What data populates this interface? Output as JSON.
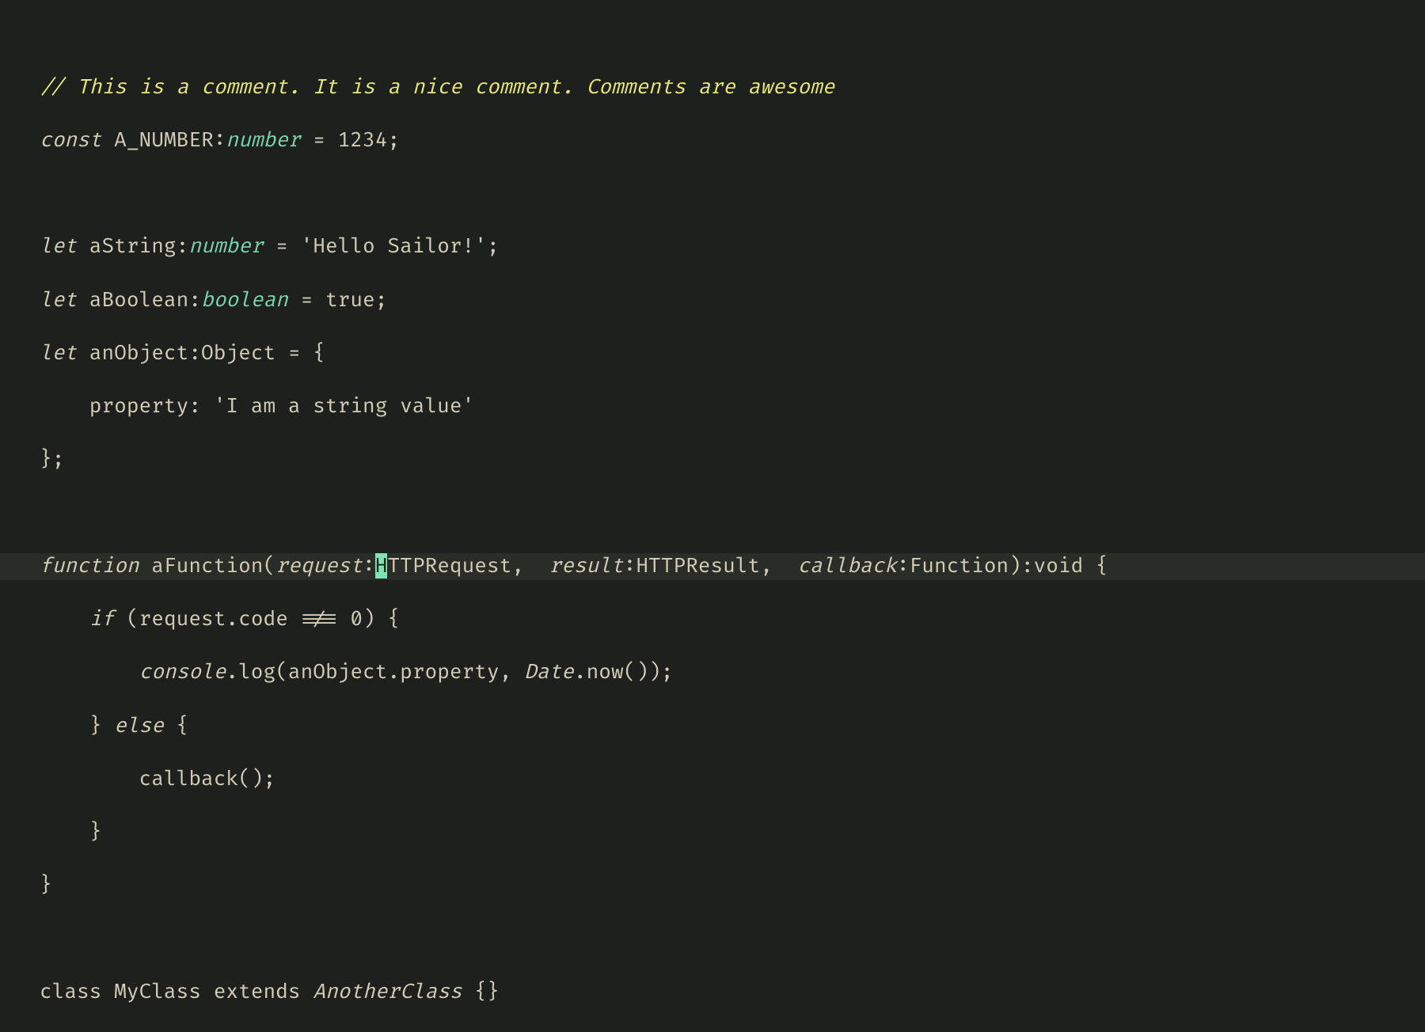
{
  "theme": {
    "bg": "#1d201c",
    "fg": "#d3cdb8",
    "comment": "#e6e87a",
    "typeAccent": "#79d4ad",
    "cursorBg": "#7fe3b4",
    "lineHighlight": "#2a2d27"
  },
  "cursor": {
    "line": 10,
    "col": 28,
    "char": "H"
  },
  "code": {
    "l1": {
      "comment": "// This is a comment. It is a nice comment. Comments are awesome"
    },
    "l2": {
      "kw": "const",
      "name": "A_NUMBER",
      "colon": ":",
      "type": "number",
      "eq": " = ",
      "val": "1234",
      "semi": ";"
    },
    "l4": {
      "kw": "let",
      "name": "aString",
      "colon": ":",
      "type": "number",
      "eq": " = ",
      "val": "'Hello Sailor!'",
      "semi": ";"
    },
    "l5": {
      "kw": "let",
      "name": "aBoolean",
      "colon": ":",
      "type": "boolean",
      "eq": " = ",
      "val": "true",
      "semi": ";"
    },
    "l6": {
      "kw": "let",
      "name": "anObject",
      "colon": ":",
      "type": "Object",
      "eq": " = ",
      "brace": "{"
    },
    "l7": {
      "indent": "    ",
      "prop": "property",
      "colon": ": ",
      "val": "'I am a string value'"
    },
    "l8": {
      "close": "};"
    },
    "l10": {
      "kw": "function",
      "name": "aFunction",
      "open": "(",
      "p1": "request",
      "c1": ":",
      "t1a": "H",
      "t1b": "TTPRequest",
      "comma1": ",  ",
      "p2": "result",
      "c2": ":",
      "t2": "HTTPResult",
      "comma2": ",  ",
      "p3": "callback",
      "c3": ":",
      "t3": "Function",
      "close": ")",
      "rcolon": ":",
      "rtype": "void",
      "brace": " {"
    },
    "l11": {
      "indent": "    ",
      "kw": "if",
      "open": " (",
      "obj": "request",
      "dot": ".",
      "prop": "code",
      "op": " !== ",
      "val": "0",
      "close": ") {"
    },
    "l12": {
      "indent": "        ",
      "obj": "console",
      "dot": ".",
      "fn": "log",
      "open": "(",
      "a1": "anObject",
      "d1": ".",
      "p1": "property",
      "comma": ", ",
      "cls": "Date",
      "d2": ".",
      "m": "now",
      "call": "()",
      "close": ");"
    },
    "l13": {
      "indent": "    ",
      "close": "}",
      "kw": " else ",
      "open": "{"
    },
    "l14": {
      "indent": "        ",
      "fn": "callback",
      "call": "();"
    },
    "l15": {
      "indent": "    ",
      "close": "}"
    },
    "l16": {
      "close": "}"
    },
    "l18": {
      "kw1": "class",
      "name": " MyClass ",
      "kw2": "extends",
      "sp": " ",
      "parent": "AnotherClass",
      "braces": " {}"
    }
  }
}
